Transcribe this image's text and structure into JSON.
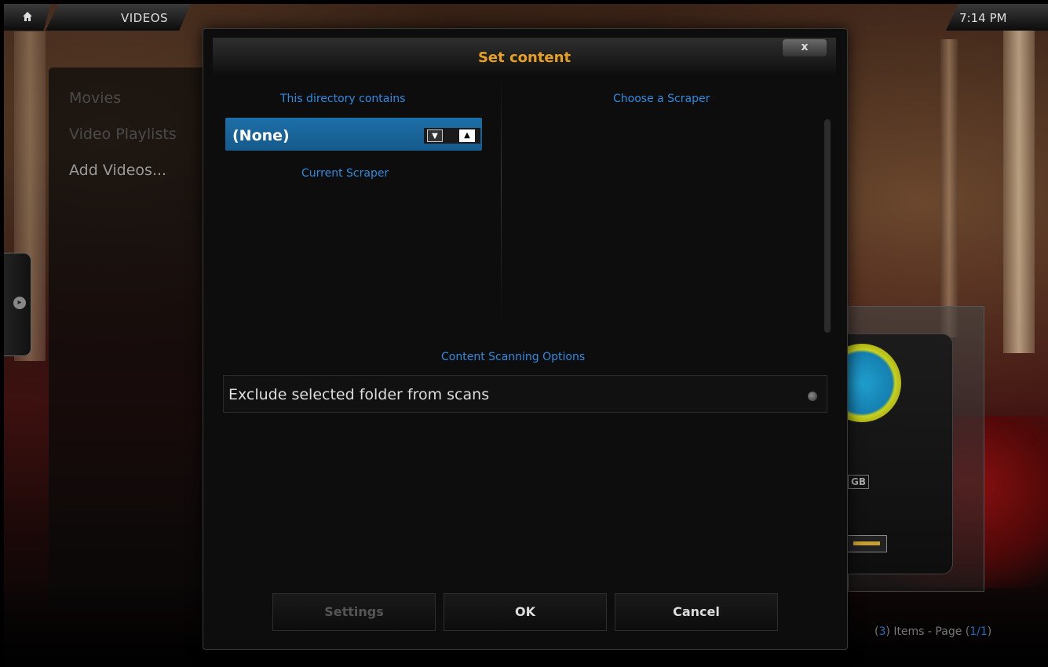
{
  "header": {
    "section": "VIDEOS",
    "time": "7:14 PM"
  },
  "sidebar": {
    "items": [
      {
        "label": "Movies",
        "color": "#4a4a4a"
      },
      {
        "label": "Video Playlists",
        "color": "#4a4a4a"
      },
      {
        "label": "Add Videos...",
        "color": "#9a9a9a"
      }
    ]
  },
  "footer": {
    "items_count": "3",
    "items_text": "Items - Page",
    "page": "1/1"
  },
  "dialog": {
    "title": "Set content",
    "close_label": "x",
    "directory_contains_label": "This directory contains",
    "content_type_value": "(None)",
    "current_scraper_label": "Current Scraper",
    "choose_scraper_label": "Choose a Scraper",
    "scanning_options_label": "Content Scanning Options",
    "exclude_option_label": "Exclude selected folder from scans",
    "buttons": {
      "settings": "Settings",
      "ok": "OK",
      "cancel": "Cancel"
    }
  },
  "drive_card": {
    "size_label": "GB"
  },
  "colors": {
    "accent_title": "#e8a020",
    "accent_blue": "#2f8be0",
    "selected_bg": "#1d6fa8"
  },
  "icons": {
    "home": "home-icon",
    "close": "close-icon",
    "spin_down": "triangle-down-icon",
    "spin_up": "triangle-up-icon",
    "radio": "radio-off-icon",
    "side_arrow": "chevron-right-icon"
  }
}
